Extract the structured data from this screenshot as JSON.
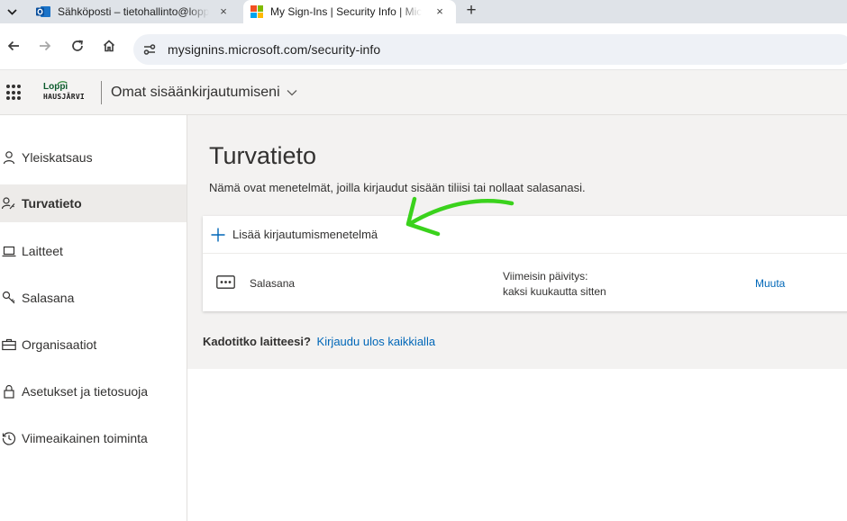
{
  "browser": {
    "tabs": [
      {
        "title": "Sähköposti – tietohallinto@loppi.fi"
      },
      {
        "title": "My Sign-Ins | Security Info | Microsoft"
      }
    ],
    "new_tab_label": "+",
    "close_label": "×",
    "url": "mysignins.microsoft.com/security-info"
  },
  "header": {
    "logo_top": "Loppi",
    "logo_bottom": "HAUSJÄRVI",
    "app_title": "Omat sisäänkirjautumiseni"
  },
  "sidebar": {
    "items": [
      {
        "label": "Yleiskatsaus",
        "icon": "person-icon"
      },
      {
        "label": "Turvatieto",
        "icon": "key-person-icon",
        "active": true
      },
      {
        "label": "Laitteet",
        "icon": "laptop-icon"
      },
      {
        "label": "Salasana",
        "icon": "key-icon"
      },
      {
        "label": "Organisaatiot",
        "icon": "briefcase-icon"
      },
      {
        "label": "Asetukset ja tietosuoja",
        "icon": "lock-icon"
      },
      {
        "label": "Viimeaikainen toiminta",
        "icon": "history-icon"
      }
    ]
  },
  "main": {
    "title": "Turvatieto",
    "description": "Nämä ovat menetelmät, joilla kirjaudut sisään tiliisi tai nollaat salasanasi.",
    "add_method_label": "Lisää kirjautumismenetelmä",
    "methods": [
      {
        "name": "Salasana",
        "updated_label": "Viimeisin päivitys:",
        "updated_value": "kaksi kuukautta sitten",
        "action_label": "Muuta"
      }
    ],
    "lost_device_question": "Kadotitko laitteesi?",
    "signout_everywhere": "Kirjaudu ulos kaikkialla"
  },
  "colors": {
    "accent_link": "#0067b8",
    "annotation_arrow": "#3ad21c"
  }
}
